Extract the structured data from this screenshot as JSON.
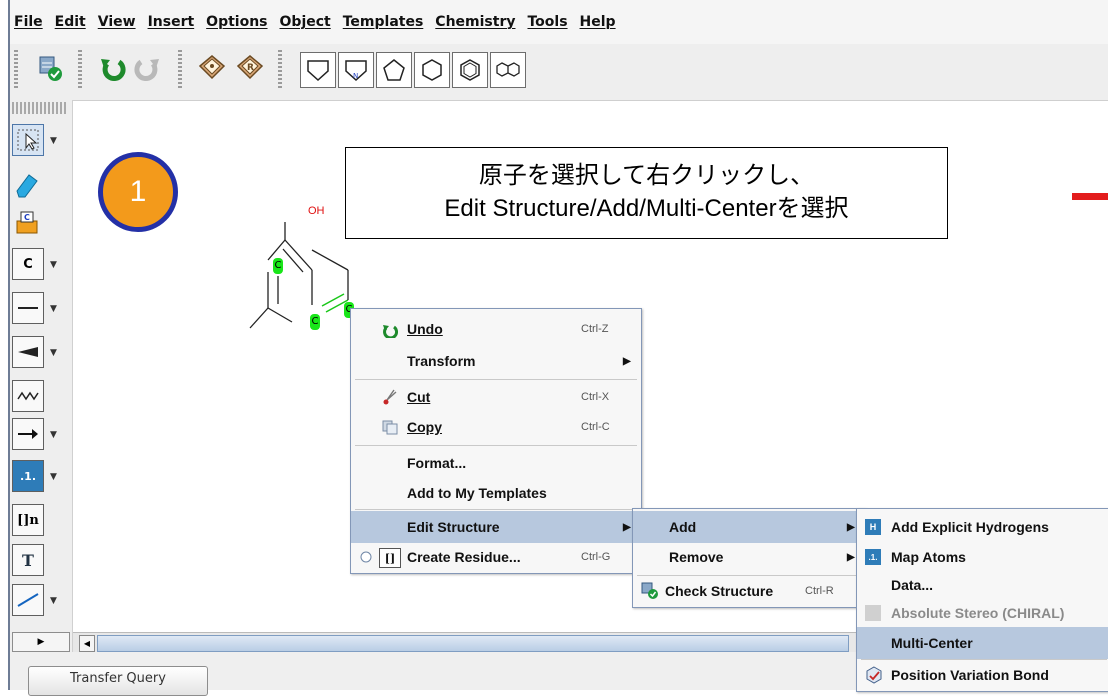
{
  "menubar": {
    "items": [
      "File",
      "Edit",
      "View",
      "Insert",
      "Options",
      "Object",
      "Templates",
      "Chemistry",
      "Tools",
      "Help"
    ]
  },
  "toolbar": {
    "icons": [
      "check-structure-icon",
      "undo-icon",
      "redo-icon",
      "template-book-icon",
      "template-book-r-icon",
      "shape-pentagon-flat-icon",
      "shape-pyrrole-icon",
      "shape-pentagon-icon",
      "shape-hexagon-icon",
      "shape-benzene-icon",
      "shape-naphthalene-icon"
    ]
  },
  "lefttools": {
    "atom_label": "C",
    "bracket_label": "[]n",
    "text_label": "T",
    "map_label": ".1."
  },
  "canvas": {
    "step_number": "1",
    "callout_line1": "原子を選択して右クリックし、",
    "callout_line2": "Edit Structure/Add/Multi-Centerを選択",
    "oh_label": "OH",
    "atom_c": "C"
  },
  "context_menu": {
    "undo": {
      "label": "Undo",
      "shortcut": "Ctrl-Z"
    },
    "transform": {
      "label": "Transform"
    },
    "cut": {
      "label": "Cut",
      "shortcut": "Ctrl-X"
    },
    "copy": {
      "label": "Copy",
      "shortcut": "Ctrl-C"
    },
    "format": {
      "label": "Format..."
    },
    "add_templates": {
      "label": "Add to My Templates"
    },
    "edit_structure": {
      "label": "Edit Structure"
    },
    "create_residue": {
      "label": "Create Residue...",
      "shortcut": "Ctrl-G"
    }
  },
  "edit_submenu": {
    "add": {
      "label": "Add"
    },
    "remove": {
      "label": "Remove"
    },
    "check": {
      "label": "Check Structure",
      "shortcut": "Ctrl-R"
    }
  },
  "add_submenu": {
    "explicit_h": {
      "label": "Add Explicit Hydrogens"
    },
    "map_atoms": {
      "label": "Map Atoms"
    },
    "data": {
      "label": "Data..."
    },
    "abs_stereo": {
      "label": "Absolute Stereo (CHIRAL)"
    },
    "multi_center": {
      "label": "Multi-Center"
    },
    "position_variation": {
      "label": "Position Variation Bond"
    }
  },
  "bottom": {
    "transfer_query": "Transfer Query"
  },
  "colors": {
    "accent_selected": "#b7c8de",
    "badge_orange": "#f39a1b",
    "badge_border": "#2430a6",
    "red_mark": "#e31c1c",
    "atom_highlight": "#19e619"
  }
}
